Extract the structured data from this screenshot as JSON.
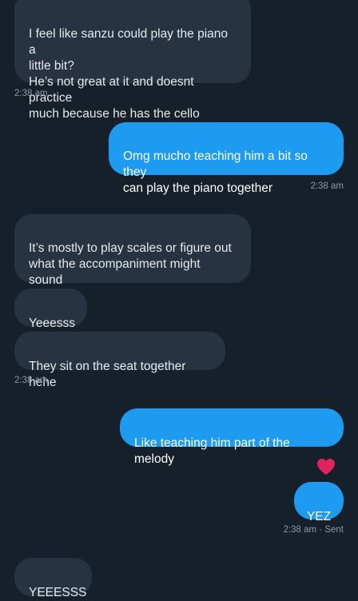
{
  "colors": {
    "background": "#15202b",
    "incoming_bubble": "#273340",
    "outgoing_bubble": "#1d9bf0",
    "timestamp": "#8b98a5",
    "heart": "#e0245e"
  },
  "messages": [
    {
      "direction": "incoming",
      "text": "I feel like sanzu could play the piano a\nlittle bit?\nHe’s not great at it and doesnt practice\nmuch because he has the cello"
    },
    {
      "direction": "incoming_timestamp",
      "text": "2:38 am"
    },
    {
      "direction": "outgoing",
      "text": "Omg mucho teaching him a bit so they\ncan play the piano together"
    },
    {
      "direction": "outgoing_timestamp",
      "text": "2:38 am"
    },
    {
      "direction": "incoming",
      "text": "It’s mostly to play scales or figure out\nwhat the accompaniment might sound\nlike"
    },
    {
      "direction": "incoming",
      "text": "Yeeesss"
    },
    {
      "direction": "incoming",
      "text": "They sit on the seat together hehe"
    },
    {
      "direction": "incoming_timestamp",
      "text": "2:38 am"
    },
    {
      "direction": "outgoing",
      "text": "Like teaching him part of the melody"
    },
    {
      "direction": "reaction",
      "icon": "heart-icon"
    },
    {
      "direction": "outgoing",
      "text": "YEZ"
    },
    {
      "direction": "outgoing_timestamp",
      "text": "2:38 am · Sent"
    },
    {
      "direction": "incoming",
      "text": "YEEESSS"
    }
  ]
}
